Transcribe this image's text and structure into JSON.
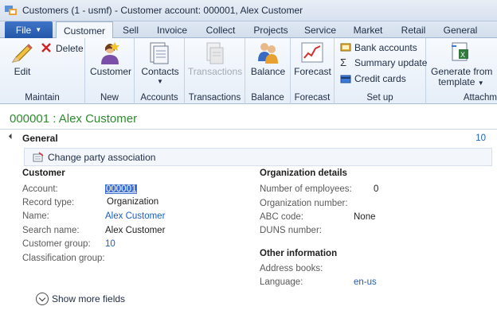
{
  "window": {
    "title": "Customers (1 - usmf) - Customer account: 000001, Alex Customer",
    "icon": "dynamics-app-icon"
  },
  "tabs": {
    "file": "File",
    "items": [
      "Customer",
      "Sell",
      "Invoice",
      "Collect",
      "Projects",
      "Service",
      "Market",
      "Retail",
      "General"
    ],
    "active": "Customer"
  },
  "ribbon": {
    "maintain": {
      "label": "Maintain",
      "edit": "Edit",
      "delete": "Delete"
    },
    "new": {
      "label": "New",
      "customer": "Customer"
    },
    "accounts": {
      "label": "Accounts",
      "contacts": "Contacts"
    },
    "transactions": {
      "label": "Transactions",
      "transactions": "Transactions"
    },
    "balance": {
      "label": "Balance",
      "balance": "Balance"
    },
    "forecast": {
      "label": "Forecast",
      "forecast": "Forecast"
    },
    "setup": {
      "label": "Set up",
      "bank_accounts": "Bank accounts",
      "summary_update": "Summary update",
      "credit_cards": "Credit cards"
    },
    "attachments": {
      "label": "Attachm",
      "generate_line1": "Generate from",
      "generate_line2": "template"
    }
  },
  "record": {
    "title": "000001 : Alex Customer"
  },
  "fasttab": {
    "title": "General",
    "count": "10",
    "change_party": "Change party association"
  },
  "customer_section": {
    "title": "Customer",
    "fields": [
      {
        "label": "Account:",
        "value": "000001"
      },
      {
        "label": "Record type:",
        "value": "Organization"
      },
      {
        "label": "Name:",
        "value": "Alex Customer"
      },
      {
        "label": "Search name:",
        "value": "Alex Customer"
      },
      {
        "label": "Customer group:",
        "value": "10"
      },
      {
        "label": "Classification group:",
        "value": ""
      }
    ]
  },
  "org_section": {
    "title": "Organization details",
    "fields": [
      {
        "label": "Number of employees:",
        "value": "0"
      },
      {
        "label": "Organization number:",
        "value": ""
      },
      {
        "label": "ABC code:",
        "value": "None"
      },
      {
        "label": "DUNS number:",
        "value": ""
      }
    ]
  },
  "other_section": {
    "title": "Other information",
    "fields": [
      {
        "label": "Address books:",
        "value": ""
      },
      {
        "label": "Language:",
        "value": "en-us"
      }
    ]
  },
  "show_more": "Show more fields",
  "colors": {
    "accent": "#2457a8",
    "record_title": "#2e8b2e",
    "link": "#1b5fb8"
  }
}
